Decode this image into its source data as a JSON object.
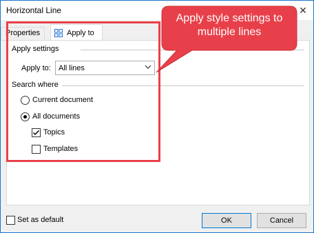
{
  "window": {
    "title": "Horizontal Line"
  },
  "tabs": [
    {
      "label": "Properties"
    },
    {
      "label": "Apply to"
    }
  ],
  "apply_settings": {
    "group_label": "Apply settings",
    "apply_to_label": "Apply to:",
    "apply_to_value": "All lines"
  },
  "search_where": {
    "group_label": "Search where",
    "options": [
      {
        "label": "Current document",
        "selected": false
      },
      {
        "label": "All documents",
        "selected": true
      }
    ],
    "checkboxes": [
      {
        "label": "Topics",
        "checked": true
      },
      {
        "label": "Templates",
        "checked": false
      }
    ]
  },
  "callout": {
    "text": "Apply style settings to multiple lines"
  },
  "footer": {
    "set_default_label": "Set as default",
    "ok_label": "OK",
    "cancel_label": "Cancel"
  },
  "colors": {
    "highlight": "#e8404a",
    "accent": "#0078d7"
  }
}
